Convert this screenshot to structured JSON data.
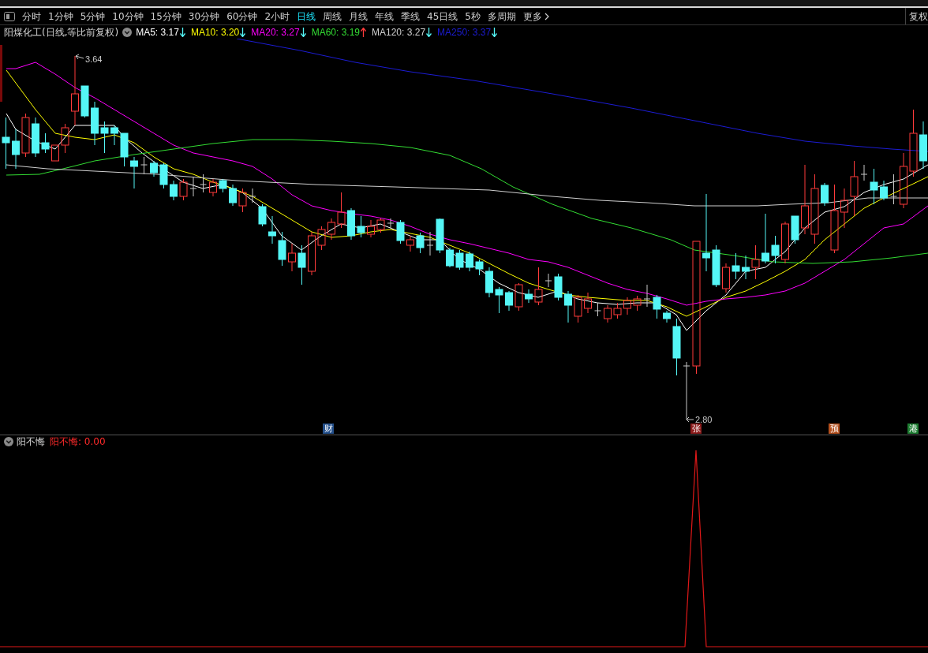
{
  "toolbar": {
    "periods": [
      {
        "label": "分时",
        "selected": false
      },
      {
        "label": "1分钟",
        "selected": false
      },
      {
        "label": "5分钟",
        "selected": false
      },
      {
        "label": "10分钟",
        "selected": false
      },
      {
        "label": "15分钟",
        "selected": false
      },
      {
        "label": "30分钟",
        "selected": false
      },
      {
        "label": "60分钟",
        "selected": false
      },
      {
        "label": "2小时",
        "selected": false
      },
      {
        "label": "日线",
        "selected": true
      },
      {
        "label": "周线",
        "selected": false
      },
      {
        "label": "月线",
        "selected": false
      },
      {
        "label": "年线",
        "selected": false
      },
      {
        "label": "季线",
        "selected": false
      },
      {
        "label": "45日线",
        "selected": false
      },
      {
        "label": "5秒",
        "selected": false
      },
      {
        "label": "多周期",
        "selected": false
      }
    ],
    "more": "更多",
    "adjust": "复权"
  },
  "header": {
    "title": "阳煤化工(日线,等比前复权)",
    "moving_averages": [
      {
        "label": "MA5: 3.17",
        "color": "#ffffff",
        "rising": false
      },
      {
        "label": "MA10: 3.20",
        "color": "#ffff00",
        "rising": false
      },
      {
        "label": "MA20: 3.27",
        "color": "#ff00ff",
        "rising": false
      },
      {
        "label": "MA60: 3.19",
        "color": "#33dd33",
        "rising": true
      },
      {
        "label": "MA120: 3.27",
        "color": "#d0d0d0",
        "rising": false
      },
      {
        "label": "MA250: 3.37",
        "color": "#1c1cd4",
        "rising": false
      }
    ]
  },
  "chart": {
    "high_label": "3.64",
    "low_label": "2.80",
    "markers": [
      {
        "label": "财",
        "color": "#24508c"
      },
      {
        "label": "张",
        "color": "#8c1c1c"
      },
      {
        "label": "预",
        "color": "#b4501e"
      },
      {
        "label": "港",
        "color": "#1e7d32"
      }
    ]
  },
  "indicator": {
    "name": "阳不悔",
    "reading": "阳不悔: 0.00"
  }
}
